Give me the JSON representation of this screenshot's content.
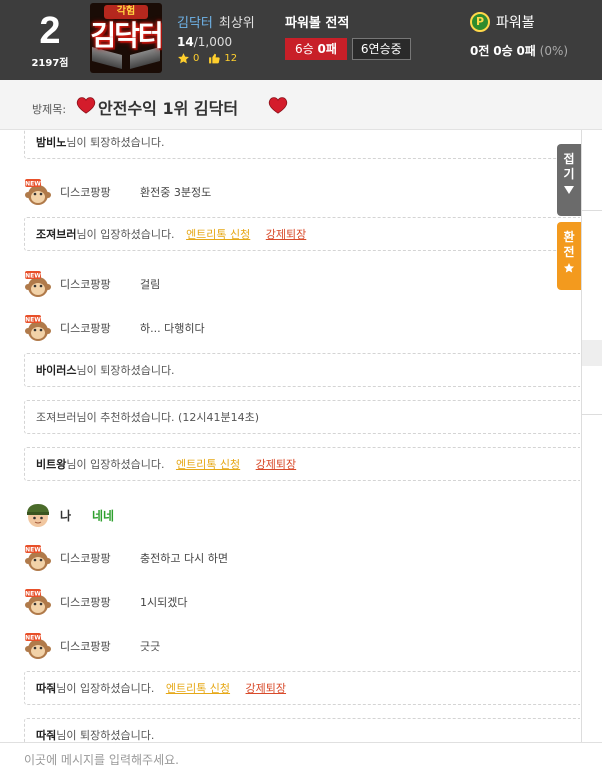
{
  "header": {
    "rank": "2",
    "points": "2197점",
    "logo_top": "각험",
    "logo_main": "김닥터",
    "user_name": "김닥터",
    "user_grade": "최상위",
    "level_current": "14",
    "level_max": "/1,000",
    "stars": "0",
    "likes": "12",
    "record_title": "파워볼 전적",
    "wins": "6승",
    "losses": "0패",
    "streak": "6연승중",
    "powerball_icon": "P",
    "powerball_label": "파워볼",
    "pb_games": "0전",
    "pb_wins": "0승",
    "pb_losses": "0패",
    "pb_pct": "(0%)"
  },
  "room": {
    "title_label": "방제목:",
    "title": "안전수익 1위 김닥터"
  },
  "side_tabs": {
    "fold": [
      "접",
      "기"
    ],
    "exchange": [
      "환",
      "전"
    ]
  },
  "links": {
    "entry": "엔트리톡 신청",
    "kick": "강제퇴장"
  },
  "messages": [
    {
      "type": "sys",
      "user": "밤비노",
      "text": "님이 퇴장하셨습니다."
    },
    {
      "type": "chat",
      "user": "디스코팡팡",
      "text": "환전중 3분정도"
    },
    {
      "type": "sys",
      "user": "조져브러",
      "text": "님이 입장하셨습니다.",
      "actions": true
    },
    {
      "type": "chat",
      "user": "디스코팡팡",
      "text": "걸림"
    },
    {
      "type": "chat",
      "user": "디스코팡팡",
      "text": "하... 다행히다"
    },
    {
      "type": "sys",
      "user": "바이러스",
      "text": "님이 퇴장하셨습니다."
    },
    {
      "type": "sys",
      "user": "조져브러",
      "text": "님이 추천하셨습니다. (12시41분14초)",
      "plain": true
    },
    {
      "type": "sys",
      "user": "비트왕",
      "text": "님이 입장하셨습니다.",
      "actions": true
    },
    {
      "type": "mine",
      "user": "나",
      "text": "네네"
    },
    {
      "type": "chat",
      "user": "디스코팡팡",
      "text": "충전하고 다시 하면"
    },
    {
      "type": "chat",
      "user": "디스코팡팡",
      "text": "1시되겠다"
    },
    {
      "type": "chat",
      "user": "디스코팡팡",
      "text": "긋긋"
    },
    {
      "type": "sys",
      "user": "따줘",
      "text": "님이 입장하셨습니다.",
      "actions": true
    },
    {
      "type": "sys",
      "user": "따줘",
      "text": "님이 퇴장하셨습니다."
    }
  ],
  "input": {
    "placeholder": "이곳에 메시지를 입력해주세요."
  },
  "colors": {
    "header_bg": "#3d3d3d",
    "win_badge": "#c81f28",
    "entry_link": "#e6a817",
    "kick_link": "#d84a2a",
    "mine_text": "#2ea02e",
    "exchange_tab": "#f39a1e"
  }
}
